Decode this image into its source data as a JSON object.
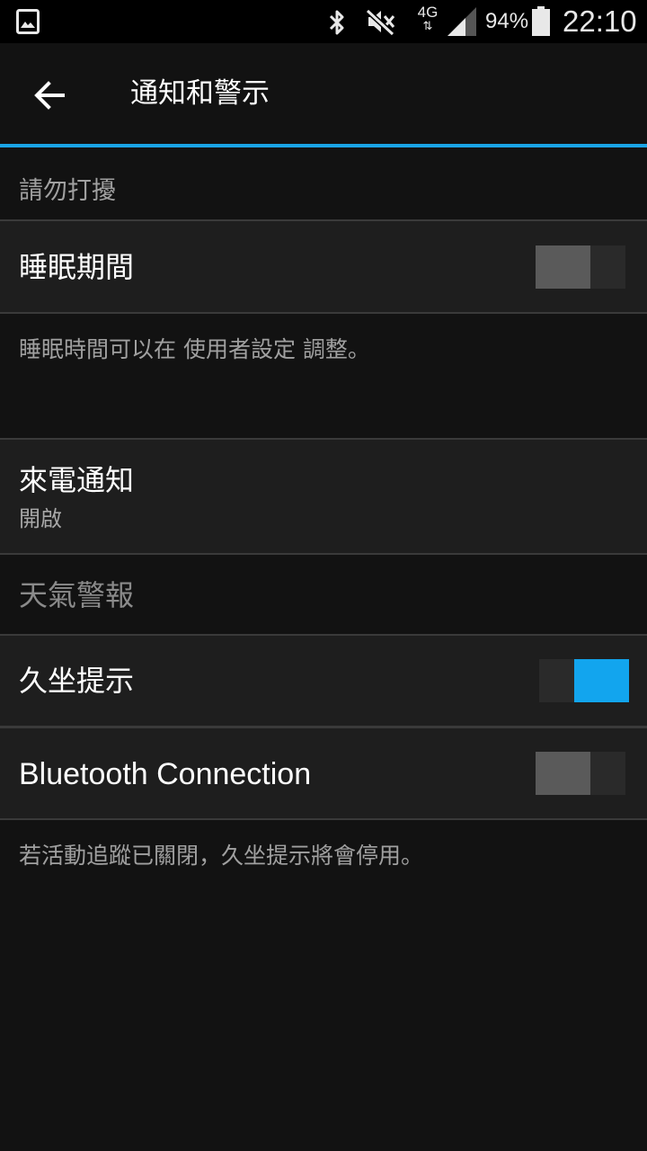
{
  "status_bar": {
    "network": "4G",
    "network_arrows": "⇅",
    "battery_percent": "94%",
    "time": "22:10"
  },
  "app_bar": {
    "title": "通知和警示",
    "back_icon": "arrow-left-icon"
  },
  "colors": {
    "accent": "#1aa4e6",
    "toggle_on": "#12a5ee",
    "toggle_off": "#5a5a5a",
    "background": "#121212",
    "row_background": "#1e1e1e"
  },
  "settings": {
    "section_dnd": "請勿打擾",
    "sleep_period": {
      "label": "睡眠期間",
      "enabled": false
    },
    "sleep_info": "睡眠時間可以在 使用者設定 調整。",
    "incoming_call": {
      "label": "來電通知",
      "value": "開啟"
    },
    "weather_alert": {
      "label": "天氣警報"
    },
    "move_alert": {
      "label": "久坐提示",
      "enabled": true
    },
    "bluetooth_connection": {
      "label": "Bluetooth Connection",
      "enabled": false
    },
    "move_alert_info": "若活動追蹤已關閉，久坐提示將會停用。"
  }
}
